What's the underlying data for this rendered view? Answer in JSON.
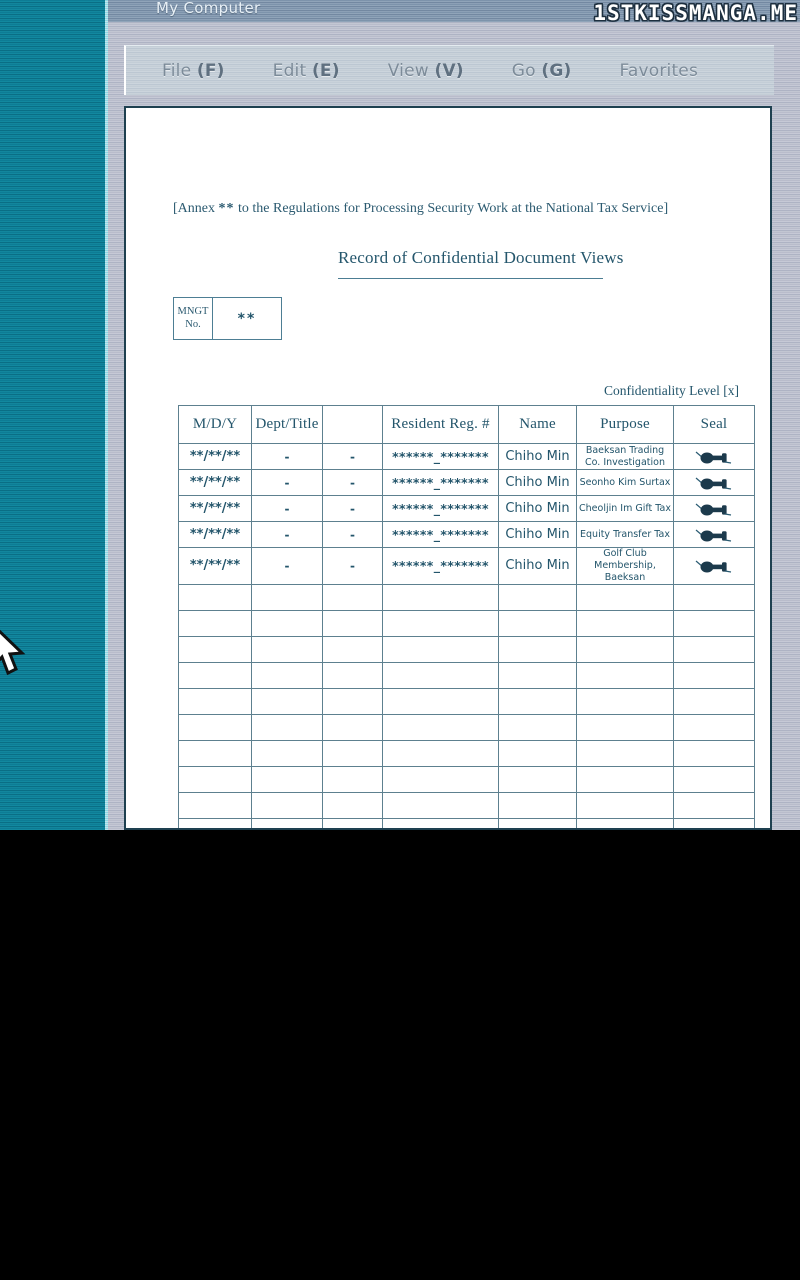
{
  "window": {
    "title": "My Computer",
    "watermark": "1STKISSMANGA.ME"
  },
  "menu": {
    "items": [
      {
        "label": "File ",
        "accel": "(F)"
      },
      {
        "label": "Edit ",
        "accel": "(E)"
      },
      {
        "label": "View ",
        "accel": "(V)"
      },
      {
        "label": "Go ",
        "accel": "(G)"
      },
      {
        "label": "Favorites",
        "accel": ""
      }
    ]
  },
  "document": {
    "annex_prefix": "[Annex ",
    "annex_stars": "**",
    "annex_suffix": " to the Regulations for Processing Security Work at the National Tax Service]",
    "title": "Record of Confidential Document Views",
    "mngt_label_line1": "MNGT",
    "mngt_label_line2": "No.",
    "mngt_value": "**",
    "confidentiality": "Confidentiality Level [x]"
  },
  "table": {
    "headers": [
      "M/D/Y",
      "Dept/Title",
      "",
      "Resident Reg. #",
      "Name",
      "Purpose",
      "Seal"
    ],
    "rows": [
      {
        "date": "**/**/**",
        "dept": "-",
        "blank": "-",
        "rrn": "******_*******",
        "name": "Chiho Min",
        "purpose": "Baeksan Trading\nCo. Investigation",
        "seal": "seal-stamp-icon"
      },
      {
        "date": "**/**/**",
        "dept": "-",
        "blank": "-",
        "rrn": "******_*******",
        "name": "Chiho Min",
        "purpose": "Seonho Kim Surtax",
        "seal": "seal-stamp-icon"
      },
      {
        "date": "**/**/**",
        "dept": "-",
        "blank": "-",
        "rrn": "******_*******",
        "name": "Chiho Min",
        "purpose": "Cheoljin Im Gift Tax",
        "seal": "seal-stamp-icon"
      },
      {
        "date": "**/**/**",
        "dept": "-",
        "blank": "-",
        "rrn": "******_*******",
        "name": "Chiho Min",
        "purpose": "Equity Transfer Tax",
        "seal": "seal-stamp-icon"
      },
      {
        "date": "**/**/**",
        "dept": "-",
        "blank": "-",
        "rrn": "******_*******",
        "name": "Chiho Min",
        "purpose": "Golf Club\nMembership, Baeksan",
        "seal": "seal-stamp-icon"
      }
    ],
    "empty_row_count": 10
  },
  "cursor": {
    "icon": "mouse-pointer-icon"
  },
  "colors": {
    "desktop_teal": "#0d7c95",
    "chrome_gray": "#b9bccb",
    "title_bar": "#7d93ab",
    "doc_ink": "#23556b",
    "table_border": "#5d808f"
  }
}
